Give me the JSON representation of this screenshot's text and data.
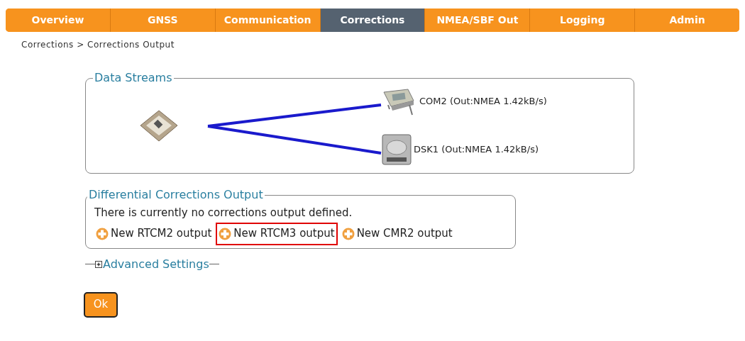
{
  "nav": [
    {
      "label": "Overview",
      "selected": false
    },
    {
      "label": "GNSS",
      "selected": false
    },
    {
      "label": "Communication",
      "selected": false
    },
    {
      "label": "Corrections",
      "selected": true
    },
    {
      "label": "NMEA/SBF Out",
      "selected": false
    },
    {
      "label": "Logging",
      "selected": false
    },
    {
      "label": "Admin",
      "selected": false
    }
  ],
  "breadcrumb": "Corrections > Corrections Output",
  "data_streams": {
    "title": "Data Streams",
    "outputs": [
      {
        "kind": "serial",
        "label": "COM2 (Out:NMEA 1.42kB/s)"
      },
      {
        "kind": "disk",
        "label": "DSK1 (Out:NMEA 1.42kB/s)"
      }
    ]
  },
  "corrections": {
    "title": "Differential Corrections Output",
    "message": "There is currently no corrections output defined.",
    "links": [
      {
        "label": "New RTCM2 output",
        "highlighted": false
      },
      {
        "label": "New RTCM3 output",
        "highlighted": true
      },
      {
        "label": "New CMR2 output",
        "highlighted": false
      }
    ]
  },
  "advanced": {
    "label": "Advanced Settings",
    "expanded": false
  },
  "ok_button": "Ok"
}
